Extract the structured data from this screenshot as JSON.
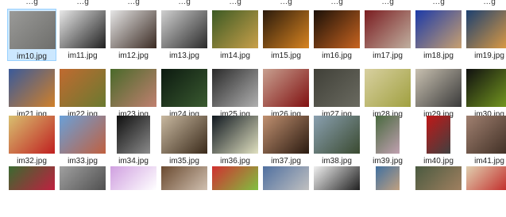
{
  "cutoff_labels": [
    "…g",
    "…g",
    "…g",
    "…g",
    "…g",
    "…g",
    "…g",
    "…g",
    "…g",
    "…g"
  ],
  "rows": [
    {
      "files": [
        {
          "name": "im10.jpg",
          "selected": true,
          "colors": [
            "#9a9a98",
            "#6e6e6b"
          ],
          "shape": "land"
        },
        {
          "name": "im11.jpg",
          "colors": [
            "#e8e8e8",
            "#202020"
          ],
          "shape": "land"
        },
        {
          "name": "im12.jpg",
          "colors": [
            "#e6e6e6",
            "#3a2a22"
          ],
          "shape": "land"
        },
        {
          "name": "im13.jpg",
          "colors": [
            "#d0d0d0",
            "#2a2a2a"
          ],
          "shape": "land"
        },
        {
          "name": "im14.jpg",
          "colors": [
            "#3c5a24",
            "#c9a04a"
          ],
          "shape": "land"
        },
        {
          "name": "im15.jpg",
          "colors": [
            "#2a1a0c",
            "#d88420"
          ],
          "shape": "land"
        },
        {
          "name": "im16.jpg",
          "colors": [
            "#1a1008",
            "#c86420"
          ],
          "shape": "land"
        },
        {
          "name": "im17.jpg",
          "colors": [
            "#7a1c20",
            "#c0b0a0"
          ],
          "shape": "land"
        },
        {
          "name": "im18.jpg",
          "colors": [
            "#1c3aa8",
            "#c8a070"
          ],
          "shape": "land"
        },
        {
          "name": "im19.jpg",
          "colors": [
            "#1c4070",
            "#e8a040"
          ],
          "shape": "land"
        }
      ]
    },
    {
      "files": [
        {
          "name": "im21.jpg",
          "colors": [
            "#3a5a9a",
            "#d0802a"
          ],
          "shape": "land"
        },
        {
          "name": "im22.jpg",
          "colors": [
            "#c06a30",
            "#6a7a30"
          ],
          "shape": "land"
        },
        {
          "name": "im23.jpg",
          "colors": [
            "#4a6a2a",
            "#c08070"
          ],
          "shape": "land"
        },
        {
          "name": "im24.jpg",
          "colors": [
            "#0c1a10",
            "#3a5a30"
          ],
          "shape": "land"
        },
        {
          "name": "im25.jpg",
          "colors": [
            "#2a2a2a",
            "#b0b0b0"
          ],
          "shape": "land"
        },
        {
          "name": "im26.jpg",
          "colors": [
            "#c8a090",
            "#801010"
          ],
          "shape": "land"
        },
        {
          "name": "im27.jpg",
          "colors": [
            "#404038",
            "#6a6a60"
          ],
          "shape": "land"
        },
        {
          "name": "im28.jpg",
          "colors": [
            "#d8d0a0",
            "#a0a040"
          ],
          "shape": "land"
        },
        {
          "name": "im29.jpg",
          "colors": [
            "#c8c0b0",
            "#3a3a3a"
          ],
          "shape": "land"
        },
        {
          "name": "im30.jpg",
          "colors": [
            "#101010",
            "#7aa020"
          ],
          "shape": "land"
        }
      ]
    },
    {
      "files": [
        {
          "name": "im32.jpg",
          "colors": [
            "#d8c070",
            "#c02020"
          ],
          "shape": "land"
        },
        {
          "name": "im33.jpg",
          "colors": [
            "#6aa0d8",
            "#c06040"
          ],
          "shape": "land"
        },
        {
          "name": "im34.jpg",
          "colors": [
            "#101010",
            "#8a8a8a"
          ],
          "shape": "tall"
        },
        {
          "name": "im35.jpg",
          "colors": [
            "#c8b8a0",
            "#3a2a1a"
          ],
          "shape": "land"
        },
        {
          "name": "im36.jpg",
          "colors": [
            "#101820",
            "#e0e0c0"
          ],
          "shape": "land"
        },
        {
          "name": "im37.jpg",
          "colors": [
            "#c09070",
            "#2a1a10"
          ],
          "shape": "land"
        },
        {
          "name": "im38.jpg",
          "colors": [
            "#8aa0b0",
            "#3a4a30"
          ],
          "shape": "land"
        },
        {
          "name": "im39.jpg",
          "colors": [
            "#4a6a40",
            "#c0a0b0"
          ],
          "shape": "portrait"
        },
        {
          "name": "im40.jpg",
          "colors": [
            "#c01818",
            "#404040"
          ],
          "shape": "portrait"
        },
        {
          "name": "im41.jpg",
          "colors": [
            "#a08070",
            "#3a2a20"
          ],
          "shape": "land"
        }
      ]
    },
    {
      "files": [
        {
          "colors": [
            "#3a6a30",
            "#c02040"
          ],
          "shape": "land"
        },
        {
          "colors": [
            "#a0a0a0",
            "#505050"
          ],
          "shape": "land"
        },
        {
          "colors": [
            "#d0a0e0",
            "#ffffff"
          ],
          "shape": "land"
        },
        {
          "colors": [
            "#6a4a30",
            "#d0c0b0"
          ],
          "shape": "land"
        },
        {
          "colors": [
            "#d03030",
            "#80c040"
          ],
          "shape": "land"
        },
        {
          "colors": [
            "#5070a0",
            "#c0c0c0"
          ],
          "shape": "land"
        },
        {
          "colors": [
            "#f0f0f0",
            "#202020"
          ],
          "shape": "land"
        },
        {
          "colors": [
            "#4070a0",
            "#c0a080"
          ],
          "shape": "portrait"
        },
        {
          "colors": [
            "#4a5a40",
            "#a08060"
          ],
          "shape": "land"
        },
        {
          "colors": [
            "#e0d0b0",
            "#c02020"
          ],
          "shape": "land"
        }
      ]
    }
  ]
}
